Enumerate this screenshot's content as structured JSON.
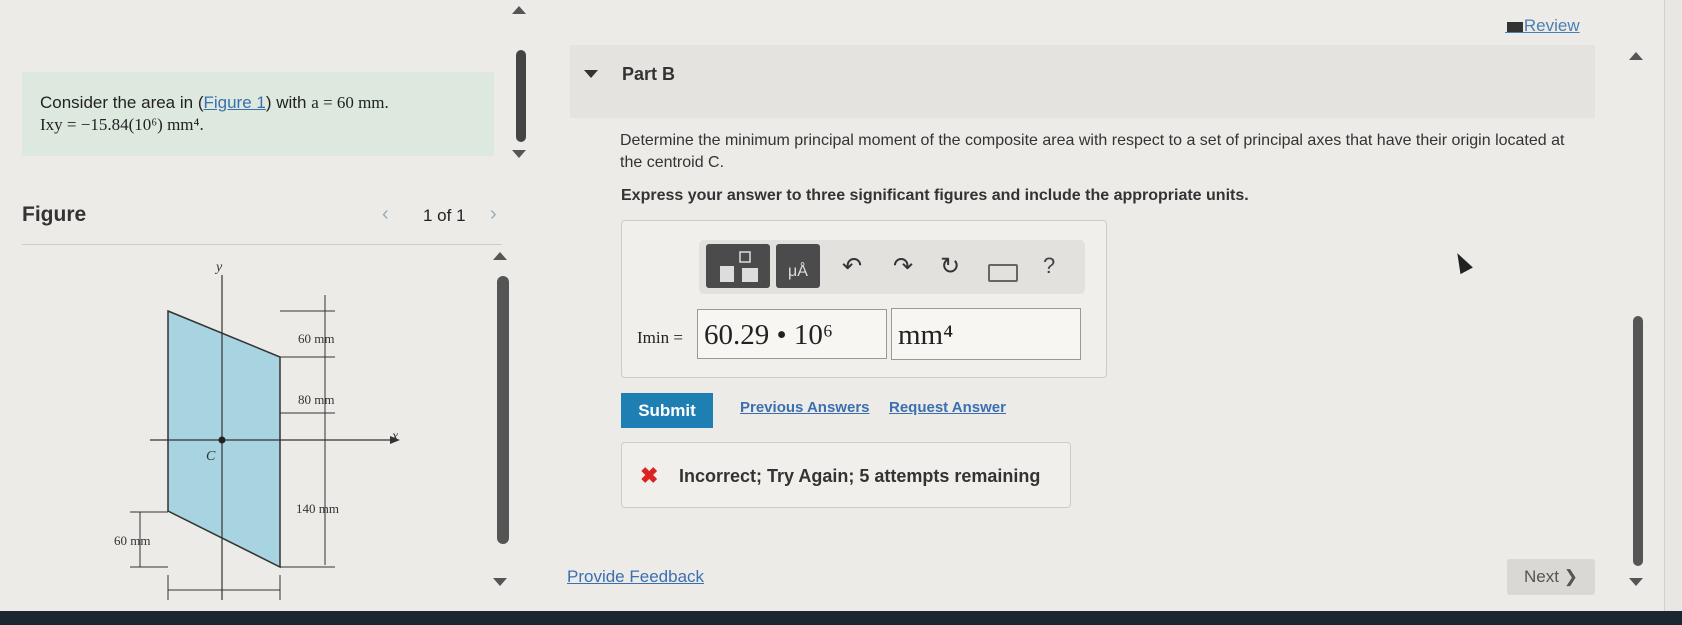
{
  "header": {
    "review_label": "Review"
  },
  "problem": {
    "line1_prefix": "Consider the area in (",
    "figure_link": "Figure 1",
    "line1_mid": ") with ",
    "line1_math": "a = 60 mm.",
    "line2": "Ixy = −15.84(10⁶) mm⁴."
  },
  "figure_panel": {
    "title": "Figure",
    "prev_icon": "chevron-left-icon",
    "next_icon": "chevron-right-icon",
    "pagination": "1 of 1",
    "labels": {
      "y_axis": "y",
      "x_axis": "x",
      "centroid": "C",
      "dim_top": "60 mm",
      "dim_mid": "80 mm",
      "dim_low": "140 mm",
      "dim_left": "60 mm"
    },
    "shape_color": "#a8d3e0"
  },
  "part": {
    "title": "Part B",
    "question": "Determine the minimum principal moment of the composite area with respect to a set of principal axes that have their origin located at the centroid C.",
    "instruction": "Express your answer to three significant figures and include the appropriate units.",
    "toolbar": {
      "templates_icon": "templates-icon",
      "units_icon": "units-icon",
      "units_glyph": "μÅ",
      "undo_icon": "undo-icon",
      "redo_icon": "redo-icon",
      "reset_icon": "reset-icon",
      "keyboard_icon": "keyboard-icon",
      "help_label": "?"
    },
    "answer_label": "Imin =",
    "answer_value": "60.29 • 10⁶",
    "answer_units": "mm⁴",
    "submit_label": "Submit",
    "previous_answers_label": "Previous Answers",
    "request_answer_label": "Request Answer",
    "feedback_icon": "x-icon",
    "feedback_text": "Incorrect; Try Again; 5 attempts remaining"
  },
  "footer": {
    "provide_feedback_label": "Provide Feedback",
    "next_label": "Next ❯"
  },
  "colors": {
    "accent": "#1e7fb3",
    "link": "#3b6fb0",
    "error": "#dd2222",
    "problem_bg": "#dde9df"
  }
}
